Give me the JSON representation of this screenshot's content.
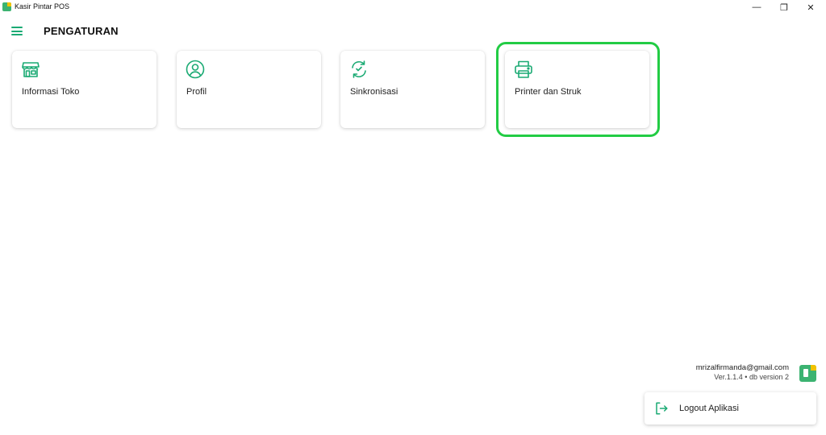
{
  "window": {
    "title": "Kasir Pintar POS",
    "controls": {
      "minimize": "—",
      "maximize": "❐",
      "close": "✕"
    }
  },
  "header": {
    "title": "PENGATURAN",
    "menu_icon": "hamburger-menu-icon"
  },
  "settings_cards": [
    {
      "label": "Informasi Toko",
      "icon": "store-icon"
    },
    {
      "label": "Profil",
      "icon": "profile-icon"
    },
    {
      "label": "Sinkronisasi",
      "icon": "sync-icon"
    },
    {
      "label": "Printer dan Struk",
      "icon": "printer-icon"
    }
  ],
  "account": {
    "email": "mrizalfirmanda@gmail.com",
    "version": "Ver.1.1.4 • db version 2"
  },
  "logout": {
    "label": "Logout Aplikasi",
    "icon": "logout-icon"
  },
  "colors": {
    "accent": "#1AAA73",
    "highlight": "#22CC44",
    "logo_green": "#3CB371",
    "logo_yellow": "#F2C200"
  }
}
